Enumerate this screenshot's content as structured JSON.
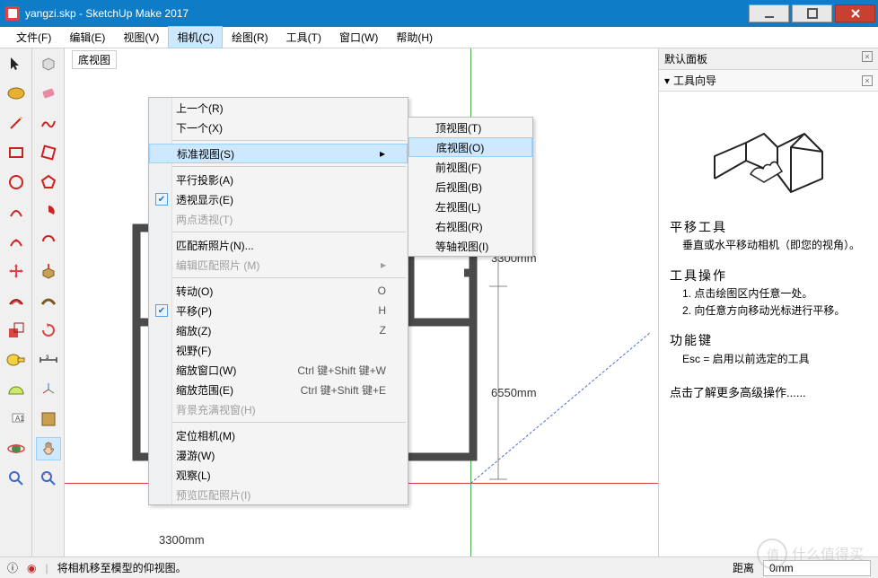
{
  "window": {
    "title": "yangzi.skp - SketchUp Make 2017"
  },
  "menubar": [
    {
      "label": "文件(F)"
    },
    {
      "label": "编辑(E)"
    },
    {
      "label": "视图(V)"
    },
    {
      "label": "相机(C)",
      "active": true
    },
    {
      "label": "绘图(R)"
    },
    {
      "label": "工具(T)"
    },
    {
      "label": "窗口(W)"
    },
    {
      "label": "帮助(H)"
    }
  ],
  "view_label": "底视图",
  "camera_menu": {
    "groups": [
      [
        {
          "label": "上一个(R)"
        },
        {
          "label": "下一个(X)"
        }
      ],
      [
        {
          "label": "标准视图(S)",
          "submenu": true,
          "highlight": true
        }
      ],
      [
        {
          "label": "平行投影(A)"
        },
        {
          "label": "透视显示(E)",
          "checked": true
        },
        {
          "label": "两点透视(T)",
          "disabled": true
        }
      ],
      [
        {
          "label": "匹配新照片(N)..."
        },
        {
          "label": "编辑匹配照片 (M)",
          "disabled": true
        }
      ],
      [
        {
          "label": "转动(O)",
          "shortcut": "O"
        },
        {
          "label": "平移(P)",
          "shortcut": "H",
          "checked": true
        },
        {
          "label": "缩放(Z)",
          "shortcut": "Z"
        },
        {
          "label": "视野(F)"
        },
        {
          "label": "缩放窗口(W)",
          "shortcut": "Ctrl 键+Shift 键+W"
        },
        {
          "label": "缩放范围(E)",
          "shortcut": "Ctrl 键+Shift 键+E"
        },
        {
          "label": "背景充满视窗(H)",
          "disabled": true
        }
      ],
      [
        {
          "label": "定位相机(M)"
        },
        {
          "label": "漫游(W)"
        },
        {
          "label": "观察(L)"
        },
        {
          "label": "预览匹配照片(I)",
          "disabled": true
        }
      ]
    ]
  },
  "views_submenu": [
    {
      "label": "顶视图(T)"
    },
    {
      "label": "底视图(O)",
      "highlight": true
    },
    {
      "label": "前视图(F)"
    },
    {
      "label": "后视图(B)"
    },
    {
      "label": "左视图(L)"
    },
    {
      "label": "右视图(R)"
    },
    {
      "label": "等轴视图(I)"
    }
  ],
  "dimensions": {
    "d1": "3300mm",
    "d2": "6550mm",
    "d3": "3300mm"
  },
  "side": {
    "header": "默认面板",
    "sub": "工具向导",
    "title": "平移工具",
    "desc": "垂直或水平移动相机（即您的视角）。",
    "op_h": "工具操作",
    "op1": "1. 点击绘图区内任意一处。",
    "op2": "2. 向任意方向移动光标进行平移。",
    "fn_h": "功能键",
    "fn1": "Esc = 启用以前选定的工具",
    "link": "点击了解更多高级操作......"
  },
  "status": {
    "msg": "将相机移至模型的仰视图。",
    "dist_label": "距离",
    "dist_val": "0mm"
  },
  "watermark": "什么值得买",
  "colors": {
    "hl": "#cde8ff",
    "title": "#0e7cc6"
  }
}
